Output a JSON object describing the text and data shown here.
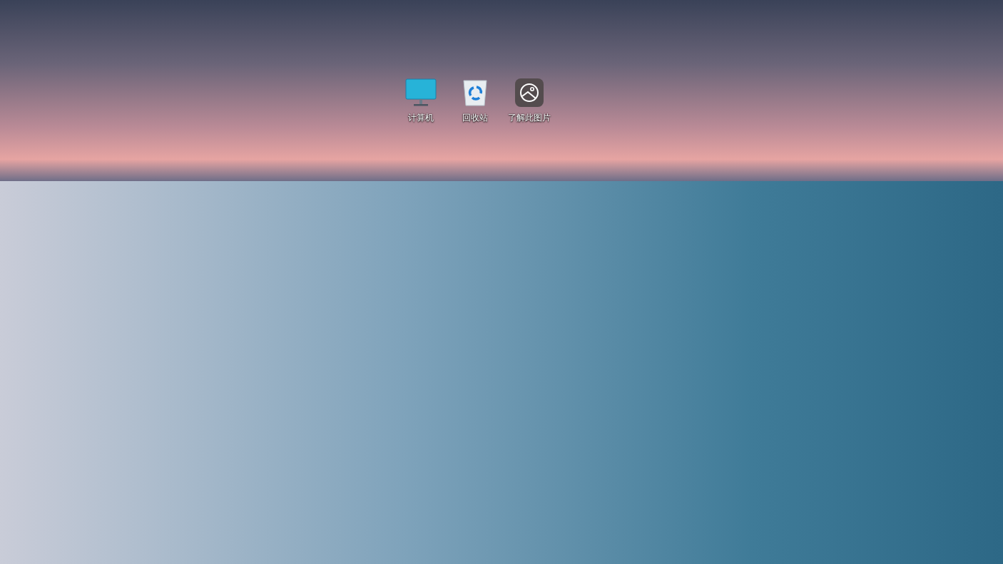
{
  "desktop_icons": [
    {
      "kind": "computer",
      "label": "计算机"
    },
    {
      "kind": "recycle-bin",
      "label": "回收站"
    },
    {
      "kind": "picture-info",
      "label": "了解此图片"
    }
  ]
}
